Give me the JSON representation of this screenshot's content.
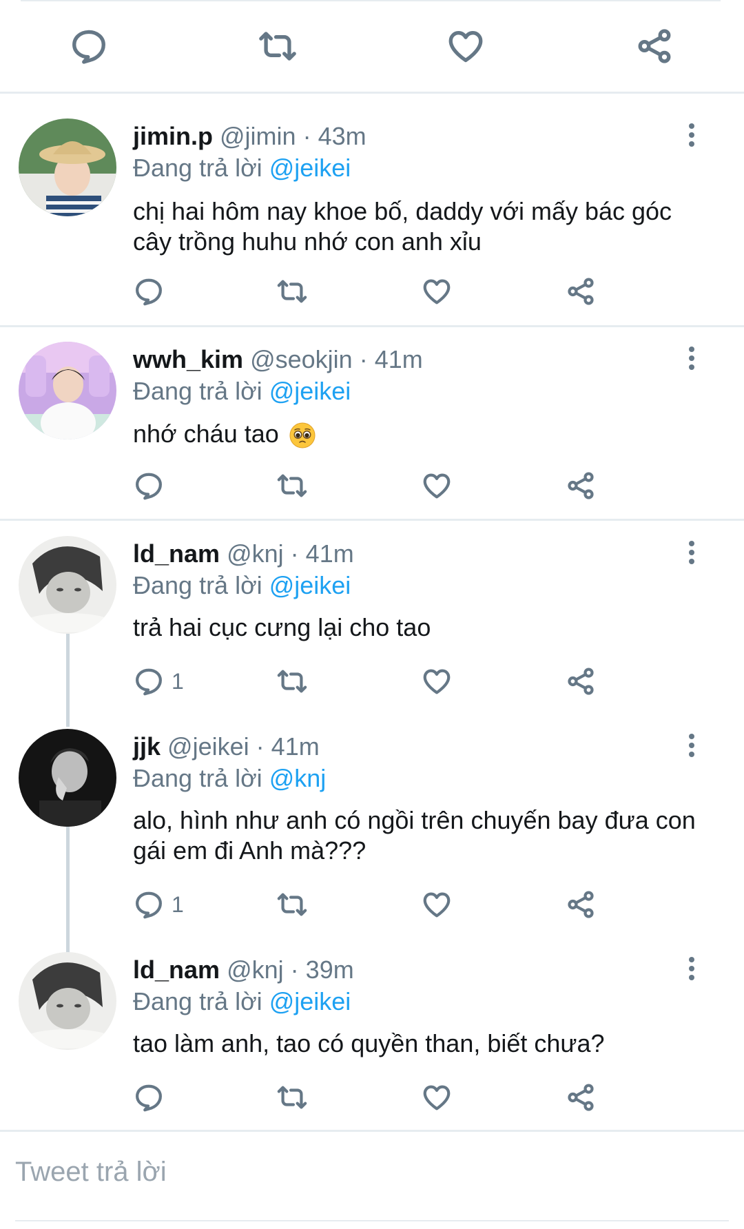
{
  "top_actions": {
    "icons": [
      "comment-icon",
      "retweet-icon",
      "heart-icon",
      "share-icon"
    ]
  },
  "tweets": [
    {
      "display_name": "jimin.p",
      "handle": "@jimin",
      "separator": "·",
      "time": "43m",
      "replying_prefix": "Đang trả lời",
      "replying_to": "@jeikei",
      "text": "chị hai hôm nay khoe bố, daddy với mấy bác góc cây trồng huhu nhớ con anh xỉu",
      "reply_count": ""
    },
    {
      "display_name": "wwh_kim",
      "handle": "@seokjin",
      "separator": "·",
      "time": "41m",
      "replying_prefix": "Đang trả lời",
      "replying_to": "@jeikei",
      "text": "nhớ cháu tao",
      "emoji": "pleading-face-emoji",
      "reply_count": ""
    },
    {
      "display_name": "ld_nam",
      "handle": "@knj",
      "separator": "·",
      "time": "41m",
      "replying_prefix": "Đang trả lời",
      "replying_to": "@jeikei",
      "text": "trả hai cục cưng lại cho tao",
      "reply_count": "1"
    },
    {
      "display_name": "jjk",
      "handle": "@jeikei",
      "separator": "·",
      "time": "41m",
      "replying_prefix": "Đang trả lời",
      "replying_to": "@knj",
      "text": "alo, hình như anh có ngồi trên chuyến bay đưa con gái em đi Anh mà???",
      "reply_count": "1"
    },
    {
      "display_name": "ld_nam",
      "handle": "@knj",
      "separator": "·",
      "time": "39m",
      "replying_prefix": "Đang trả lời",
      "replying_to": "@jeikei",
      "text": "tao làm anh, tao có quyền than, biết chưa?",
      "reply_count": ""
    }
  ],
  "reply_bar": {
    "placeholder": "Tweet trả lời"
  },
  "colors": {
    "link": "#1da1f2",
    "secondary_text": "#657786",
    "divider": "#e6ecf0",
    "thread_line": "#ccd6dd"
  }
}
